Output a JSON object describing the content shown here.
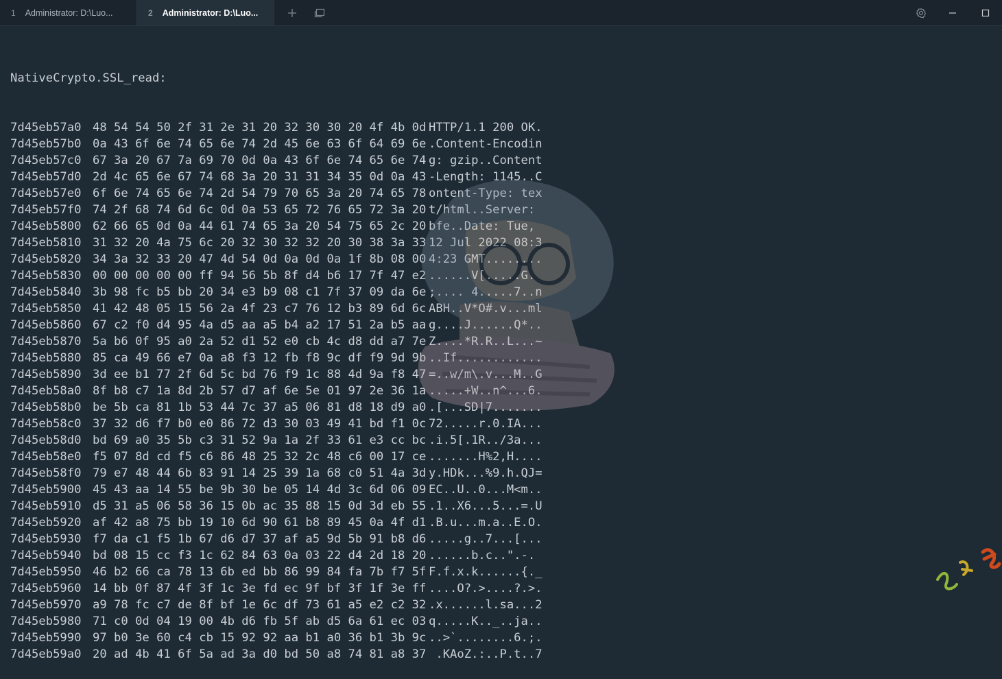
{
  "tabs": [
    {
      "number": "1",
      "title": "Administrator: D:\\Luo..."
    },
    {
      "number": "2",
      "title": "Administrator: D:\\Luo...",
      "active": true
    }
  ],
  "icons": {
    "new_tab": "plus-icon",
    "tab_menu": "tab-overview-icon",
    "settings": "gear-icon",
    "minimize": "minimize-icon",
    "maximize": "maximize-icon"
  },
  "terminal": {
    "header": "NativeCrypto.SSL_read:",
    "rows": [
      {
        "addr": "7d45eb57a0",
        "hex": "48 54 54 50 2f 31 2e 31 20 32 30 30 20 4f 4b 0d",
        "ascii": "HTTP/1.1 200 OK."
      },
      {
        "addr": "7d45eb57b0",
        "hex": "0a 43 6f 6e 74 65 6e 74 2d 45 6e 63 6f 64 69 6e",
        "ascii": ".Content-Encodin"
      },
      {
        "addr": "7d45eb57c0",
        "hex": "67 3a 20 67 7a 69 70 0d 0a 43 6f 6e 74 65 6e 74",
        "ascii": "g: gzip..Content"
      },
      {
        "addr": "7d45eb57d0",
        "hex": "2d 4c 65 6e 67 74 68 3a 20 31 31 34 35 0d 0a 43",
        "ascii": "-Length: 1145..C"
      },
      {
        "addr": "7d45eb57e0",
        "hex": "6f 6e 74 65 6e 74 2d 54 79 70 65 3a 20 74 65 78",
        "ascii": "ontent-Type: tex"
      },
      {
        "addr": "7d45eb57f0",
        "hex": "74 2f 68 74 6d 6c 0d 0a 53 65 72 76 65 72 3a 20",
        "ascii": "t/html..Server: "
      },
      {
        "addr": "7d45eb5800",
        "hex": "62 66 65 0d 0a 44 61 74 65 3a 20 54 75 65 2c 20",
        "ascii": "bfe..Date: Tue, "
      },
      {
        "addr": "7d45eb5810",
        "hex": "31 32 20 4a 75 6c 20 32 30 32 32 20 30 38 3a 33",
        "ascii": "12 Jul 2022 08:3"
      },
      {
        "addr": "7d45eb5820",
        "hex": "34 3a 32 33 20 47 4d 54 0d 0a 0d 0a 1f 8b 08 00",
        "ascii": "4:23 GMT........"
      },
      {
        "addr": "7d45eb5830",
        "hex": "00 00 00 00 00 ff 94 56 5b 8f d4 b6 17 7f 47 e2",
        "ascii": "......V[.....G."
      },
      {
        "addr": "7d45eb5840",
        "hex": "3b 98 fc b5 bb 20 34 e3 b9 08 c1 7f 37 09 da 6e",
        "ascii": ";.... 4.....7..n"
      },
      {
        "addr": "7d45eb5850",
        "hex": "41 42 48 05 15 56 2a 4f 23 c7 76 12 b3 89 6d 6c",
        "ascii": "ABH..V*O#.v...ml"
      },
      {
        "addr": "7d45eb5860",
        "hex": "67 c2 f0 d4 95 4a d5 aa a5 b4 a2 17 51 2a b5 aa",
        "ascii": "g....J......Q*.."
      },
      {
        "addr": "7d45eb5870",
        "hex": "5a b6 0f 95 a0 2a 52 d1 52 e0 cb 4c d8 dd a7 7e",
        "ascii": "Z....*R.R..L...~"
      },
      {
        "addr": "7d45eb5880",
        "hex": "85 ca 49 66 e7 0a a8 f3 12 fb f8 9c df f9 9d 9b",
        "ascii": "..If............"
      },
      {
        "addr": "7d45eb5890",
        "hex": "3d ee b1 77 2f 6d 5c bd 76 f9 1c 88 4d 9a f8 47",
        "ascii": "=..w/m\\.v...M..G"
      },
      {
        "addr": "7d45eb58a0",
        "hex": "8f b8 c7 1a 8d 2b 57 d7 af 6e 5e 01 97 2e 36 1a",
        "ascii": ".....+W..n^...6."
      },
      {
        "addr": "7d45eb58b0",
        "hex": "be 5b ca 81 1b 53 44 7c 37 a5 06 81 d8 18 d9 a0",
        "ascii": ".[...SD|7......."
      },
      {
        "addr": "7d45eb58c0",
        "hex": "37 32 d6 f7 b0 e0 86 72 d3 30 03 49 41 bd f1 0c",
        "ascii": "72.....r.0.IA..."
      },
      {
        "addr": "7d45eb58d0",
        "hex": "bd 69 a0 35 5b c3 31 52 9a 1a 2f 33 61 e3 cc bc",
        "ascii": ".i.5[.1R../3a..."
      },
      {
        "addr": "7d45eb58e0",
        "hex": "f5 07 8d cd f5 c6 86 48 25 32 2c 48 c6 00 17 ce",
        "ascii": ".......H%2,H...."
      },
      {
        "addr": "7d45eb58f0",
        "hex": "79 e7 48 44 6b 83 91 14 25 39 1a 68 c0 51 4a 3d",
        "ascii": "y.HDk...%9.h.QJ="
      },
      {
        "addr": "7d45eb5900",
        "hex": "45 43 aa 14 55 be 9b 30 be 05 14 4d 3c 6d 06 09",
        "ascii": "EC..U..0...M<m.."
      },
      {
        "addr": "7d45eb5910",
        "hex": "d5 31 a5 06 58 36 15 0b ac 35 88 15 0d 3d eb 55",
        "ascii": ".1..X6...5...=.U"
      },
      {
        "addr": "7d45eb5920",
        "hex": "af 42 a8 75 bb 19 10 6d 90 61 b8 89 45 0a 4f d1",
        "ascii": ".B.u...m.a..E.O."
      },
      {
        "addr": "7d45eb5930",
        "hex": "f7 da c1 f5 1b 67 d6 d7 37 af a5 9d 5b 91 b8 d6",
        "ascii": ".....g..7...[..."
      },
      {
        "addr": "7d45eb5940",
        "hex": "bd 08 15 cc f3 1c 62 84 63 0a 03 22 d4 2d 18 20",
        "ascii": "......b.c..\".-. "
      },
      {
        "addr": "7d45eb5950",
        "hex": "46 b2 66 ca 78 13 6b ed bb 86 99 84 fa 7b f7 5f",
        "ascii": "F.f.x.k......{._"
      },
      {
        "addr": "7d45eb5960",
        "hex": "14 bb 0f 87 4f 3f 1c 3e fd ec 9f bf 3f 1f 3e ff",
        "ascii": "....O?.>....?.>."
      },
      {
        "addr": "7d45eb5970",
        "hex": "a9 78 fc c7 de 8f bf 1e 6c df 73 61 a5 e2 c2 32",
        "ascii": ".x......l.sa...2"
      },
      {
        "addr": "7d45eb5980",
        "hex": "71 c0 0d 04 19 00 4b d6 fb 5f ab d5 6a 61 ec 03",
        "ascii": "q.....K.._..ja.."
      },
      {
        "addr": "7d45eb5990",
        "hex": "97 b0 3e 60 c4 cb 15 92 92 aa b1 a0 36 b1 3b 9c",
        "ascii": "..>`........6.;."
      },
      {
        "addr": "7d45eb59a0",
        "hex": "20 ad 4b 41 6f 5a ad 3a d0 bd 50 a8 74 81 a8 37",
        "ascii": " .KAoZ.:..P.t..7"
      }
    ]
  },
  "colors": {
    "background": "#1e2a34",
    "titlebar": "#1b242c",
    "text": "#c8ced4",
    "active_tab": "#24303a"
  }
}
